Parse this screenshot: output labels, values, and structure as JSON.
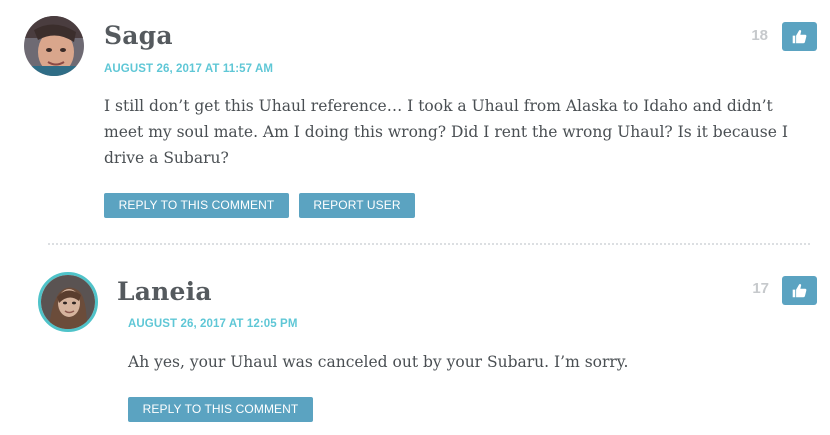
{
  "comments": [
    {
      "author": "Saga",
      "date": "AUGUST 26, 2017 AT 11:57 AM",
      "body": "I still don’t get this Uhaul reference… I took a Uhaul from Alaska to Idaho and didn’t meet my soul mate. Am I doing this wrong? Did I rent the wrong Uhaul? Is it because I drive a Subaru?",
      "votes": "18",
      "reply_label": "REPLY TO THIS COMMENT",
      "report_label": "REPORT USER"
    },
    {
      "author": "Laneia",
      "date": "AUGUST 26, 2017 AT 12:05 PM",
      "body": "Ah yes, your Uhaul was canceled out by your Subaru. I’m sorry.",
      "votes": "17",
      "reply_label": "REPLY TO THIS COMMENT"
    }
  ],
  "colors": {
    "accent": "#5ba3c1",
    "date": "#5fc7d6",
    "avatar_ring": "#4fc3c9",
    "vote_count": "#c6c9cc",
    "author": "#555a5e"
  },
  "icons": {
    "like": "thumbs-up-icon"
  }
}
